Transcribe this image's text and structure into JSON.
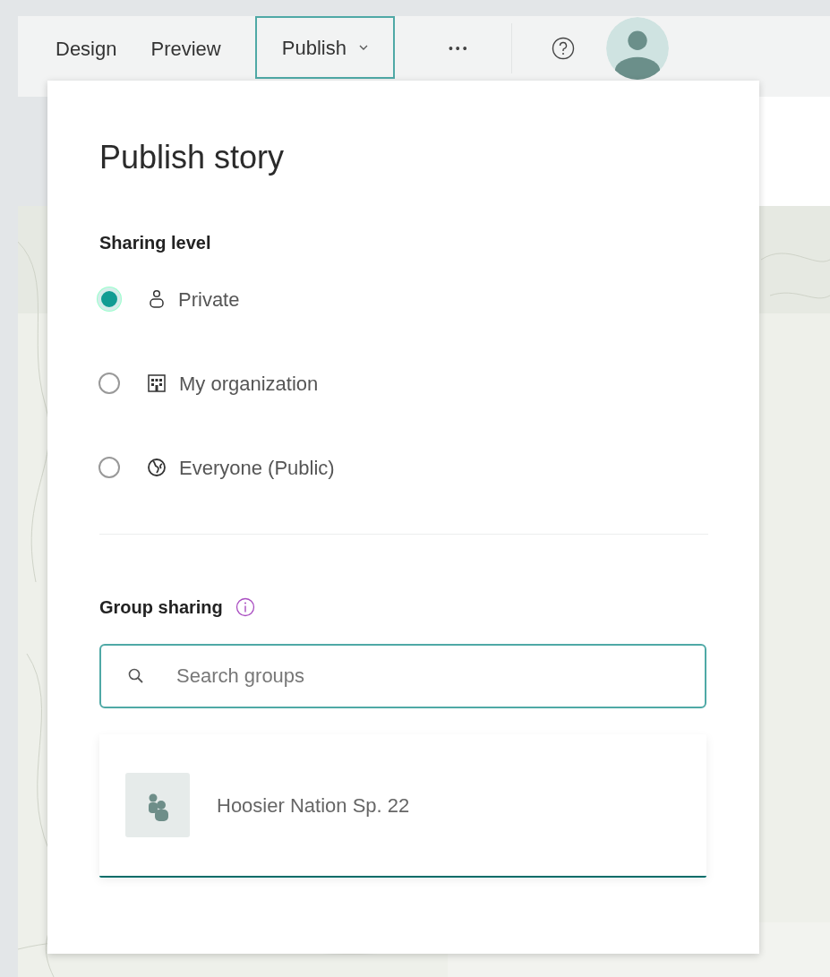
{
  "toolbar": {
    "tabs": [
      {
        "label": "Design",
        "selected": false
      },
      {
        "label": "Preview",
        "selected": false
      },
      {
        "label": "Publish",
        "selected": true,
        "menu": true
      }
    ],
    "more": "•••"
  },
  "panel": {
    "title": "Publish story",
    "sharing_heading": "Sharing level",
    "options": [
      {
        "label": "Private",
        "kind": "person",
        "selected": true
      },
      {
        "label": "My organization",
        "kind": "building",
        "selected": false
      },
      {
        "label": "Everyone (Public)",
        "kind": "globe",
        "selected": false
      }
    ],
    "group_heading": "Group sharing",
    "search": {
      "placeholder": "Search groups"
    },
    "results": [
      {
        "name": "Hoosier Nation Sp. 22"
      }
    ]
  }
}
